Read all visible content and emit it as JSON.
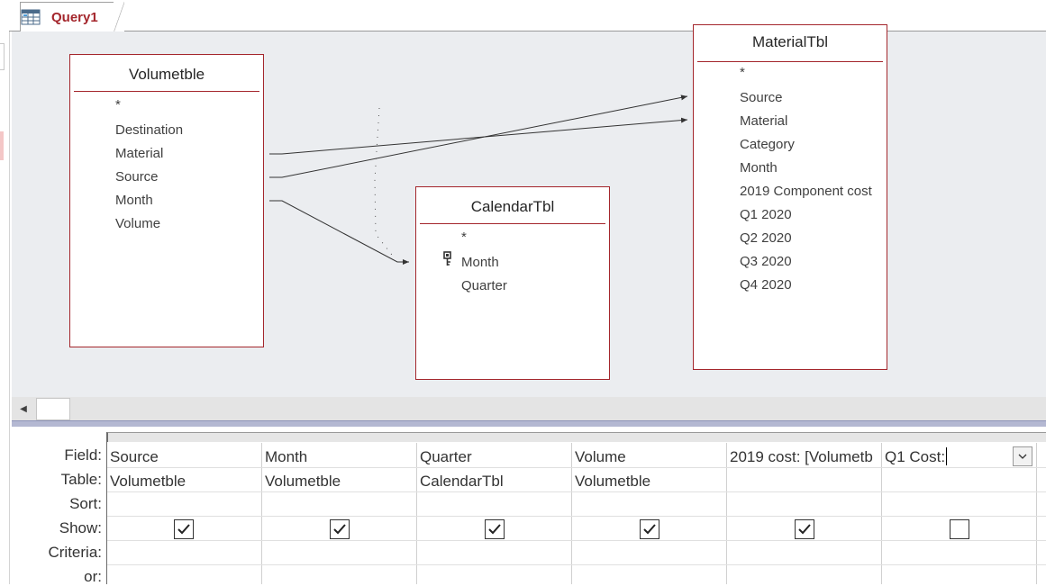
{
  "tab": {
    "label": "Query1",
    "icon": "query-design-icon",
    "accent": "#a4262c"
  },
  "tables": {
    "volume": {
      "title": "Volumetble",
      "fields": [
        "*",
        "Destination",
        "Material",
        "Source",
        "Month",
        "Volume"
      ]
    },
    "calendar": {
      "title": "CalendarTbl",
      "fields": [
        "*",
        "Month",
        "Quarter"
      ],
      "key_field": "Month"
    },
    "material": {
      "title": "MaterialTbl",
      "fields": [
        "*",
        "Source",
        "Material",
        "Category",
        "Month",
        "2019 Component cost",
        "Q1 2020",
        "Q2 2020",
        "Q3 2020",
        "Q4 2020"
      ]
    }
  },
  "grid": {
    "row_labels": [
      "Field:",
      "Table:",
      "Sort:",
      "Show:",
      "Criteria:",
      "or:"
    ],
    "columns": [
      {
        "field": "Source",
        "table": "Volumetble",
        "show": true
      },
      {
        "field": "Month",
        "table": "Volumetble",
        "show": true
      },
      {
        "field": "Quarter",
        "table": "CalendarTbl",
        "show": true
      },
      {
        "field": "Volume",
        "table": "Volumetble",
        "show": true
      },
      {
        "field": "2019 cost: [Volumetb",
        "table": "",
        "show": true
      },
      {
        "field": "Q1 Cost:",
        "table": "",
        "show": false
      }
    ]
  }
}
